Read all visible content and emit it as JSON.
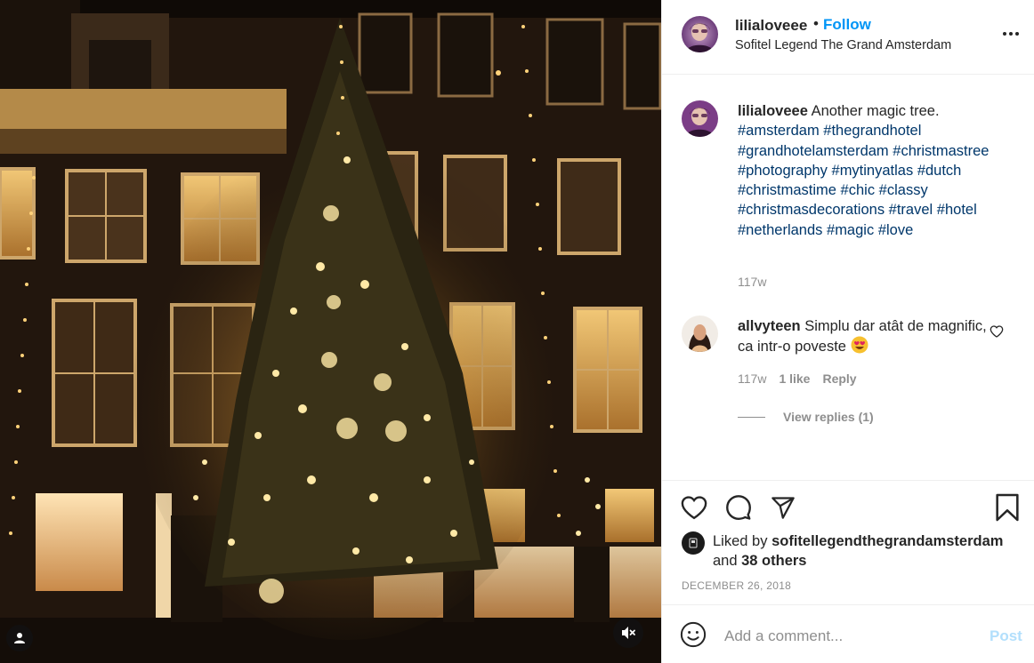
{
  "post": {
    "username": "lilialoveee",
    "follow_label": "Follow",
    "separator": "•",
    "location": "Sofitel Legend The Grand Amsterdam",
    "more_icon": "more-horizontal-icon"
  },
  "caption": {
    "username": "lilialoveee",
    "text": "Another magic tree.",
    "hashtags": [
      "#amsterdam",
      "#thegrandhotel",
      "#grandhotelamsterdam",
      "#christmastree",
      "#photography",
      "#mytinyatlas",
      "#dutch",
      "#christmastime",
      "#chic",
      "#classy",
      "#christmasdecorations",
      "#travel",
      "#hotel",
      "#netherlands",
      "#magic",
      "#love"
    ],
    "time": "117w"
  },
  "comment": {
    "username": "allvyteen",
    "text": "Simplu dar atât de magnific, ca intr-o poveste",
    "emoji": "heart-eyes-emoji",
    "time": "117w",
    "likes": "1 like",
    "reply_label": "Reply",
    "view_replies": "View replies (1)"
  },
  "actions": {
    "icons": [
      "heart-icon",
      "comment-icon",
      "share-icon",
      "bookmark-icon"
    ]
  },
  "liked_by": {
    "prefix": "Liked by",
    "user": "sofitellegendthegrandamsterdam",
    "and": "and",
    "others": "38 others"
  },
  "date": "DECEMBER 26, 2018",
  "add_comment": {
    "placeholder": "Add a comment...",
    "post_label": "Post"
  },
  "media": {
    "description_icon": "christmas-tree-night-photo",
    "user_tag_icon": "user-tag-icon",
    "mute_icon": "muted-speaker-icon"
  },
  "colors": {
    "link_blue": "#0095f6",
    "hashtag_blue": "#00376b",
    "muted_gray": "#8e8e8e",
    "post_disabled": "#b2dffc"
  }
}
